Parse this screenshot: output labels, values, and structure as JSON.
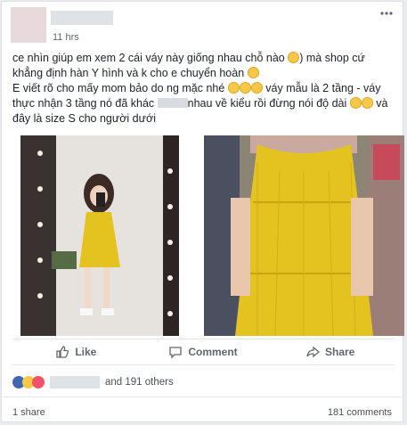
{
  "post": {
    "timestamp": "11 hrs",
    "text_parts": {
      "line1a": "ce nhìn giúp em xem 2 cái váy này giống nhau chỗ nào ",
      "line1b": ") mà shop cứ khẳng định hàn Y hình và k cho e chuyển hoàn ",
      "line2a": "E viết rõ cho mấy mom bảo do ng mặc nhé ",
      "line2b": " váy mẫu là 2 tầng - váy thực nhận 3 tầng nó đã khác ",
      "line2c": "nhau về kiểu rồi đừng nói độ dài ",
      "line2d": " và đây là size S cho người dưới"
    }
  },
  "actions": {
    "like": "Like",
    "comment": "Comment",
    "share": "Share"
  },
  "stats": {
    "reactions_others": "and 191 others",
    "shares": "1 share",
    "comments": "181 comments"
  },
  "colors": {
    "brand_blue": "#4267b2",
    "dress_yellow": "#e4c21f"
  },
  "icons": [
    "more-options-icon",
    "like-icon",
    "comment-icon",
    "share-icon",
    "like-reaction-icon",
    "haha-reaction-icon",
    "love-reaction-icon"
  ]
}
